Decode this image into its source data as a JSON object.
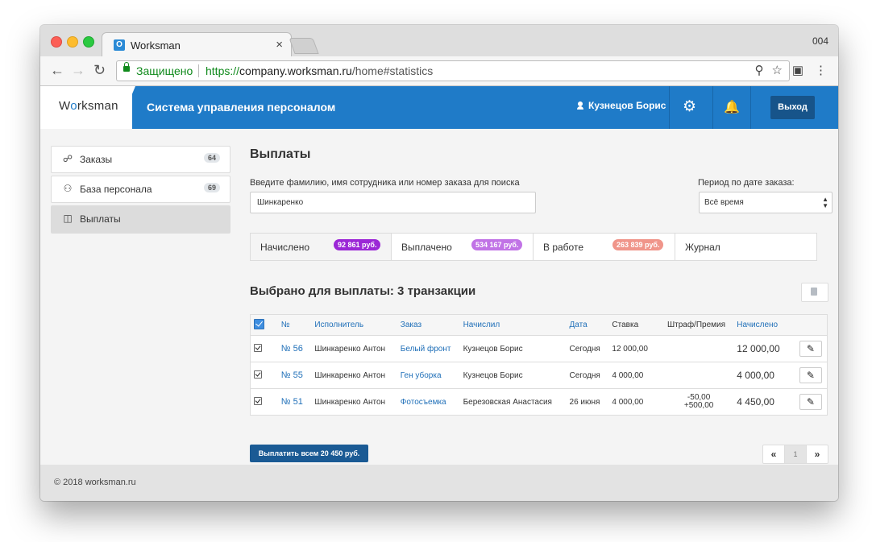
{
  "browser": {
    "tab_title": "Worksman",
    "tab_favicon": "O",
    "tab_close": "×",
    "profile": "004",
    "secure_label": "Защищено",
    "url_scheme": "https://",
    "url_host": "company.worksman.ru",
    "url_path": "/home#statistics"
  },
  "header": {
    "brand_prefix": "W",
    "brand_o": "o",
    "brand_suffix": "rksman",
    "app_title": "Система управления персоналом",
    "user_name": "Кузнецов Борис",
    "logout_label": "Выход"
  },
  "sidebar": {
    "items": [
      {
        "label": "Заказы",
        "badge": "64",
        "icon": "handshake-icon"
      },
      {
        "label": "База персонала",
        "badge": "69",
        "icon": "users-icon"
      },
      {
        "label": "Выплаты",
        "badge": "",
        "icon": "money-icon"
      }
    ]
  },
  "main": {
    "title": "Выплаты",
    "search_label": "Введите фамилию, имя сотрудника или номер заказа для поиска",
    "search_value": "Шинкаренко",
    "period_label": "Период по дате заказа:",
    "period_value": "Всё время",
    "tabs": [
      {
        "label": "Начислено",
        "badge": "92 861 руб.",
        "color": "#9b27d6"
      },
      {
        "label": "Выплачено",
        "badge": "534 167 руб.",
        "color": "#c173e6"
      },
      {
        "label": "В работе",
        "badge": "263 839 руб.",
        "color": "#f0958a"
      },
      {
        "label": "Журнал",
        "badge": "",
        "color": ""
      }
    ],
    "selected_title": "Выбрано для выплаты: 3 транзакции",
    "table": {
      "columns": [
        "№",
        "Исполнитель",
        "Заказ",
        "Начислил",
        "Дата",
        "Ставка",
        "Штраф/Премия",
        "Начислено"
      ],
      "rows": [
        {
          "num": "№ 56",
          "worker": "Шинкаренко Антон",
          "order": "Белый фронт",
          "by": "Кузнецов Борис",
          "date": "Сегодня",
          "rate": "12 000,00",
          "fine": "",
          "bonus": "",
          "total": "12 000,00"
        },
        {
          "num": "№ 55",
          "worker": "Шинкаренко Антон",
          "order": "Ген уборка",
          "by": "Кузнецов Борис",
          "date": "Сегодня",
          "rate": "4 000,00",
          "fine": "",
          "bonus": "",
          "total": "4 000,00"
        },
        {
          "num": "№ 51",
          "worker": "Шинкаренко Антон",
          "order": "Фотосъемка",
          "by": "Березовская Анастасия",
          "date": "26 июня",
          "rate": "4 000,00",
          "fine": "-50,00",
          "bonus": "+500,00",
          "total": "4 450,00"
        }
      ]
    },
    "pay_button": "Выплатить всем 20 450 руб.",
    "pager": {
      "prev": "«",
      "current": "1",
      "next": "»"
    }
  },
  "footer": {
    "text": "© 2018 worksman.ru"
  },
  "colors": {
    "accent": "#1f7bc8",
    "button_dark": "#17548a",
    "link": "#1f6fb8"
  }
}
